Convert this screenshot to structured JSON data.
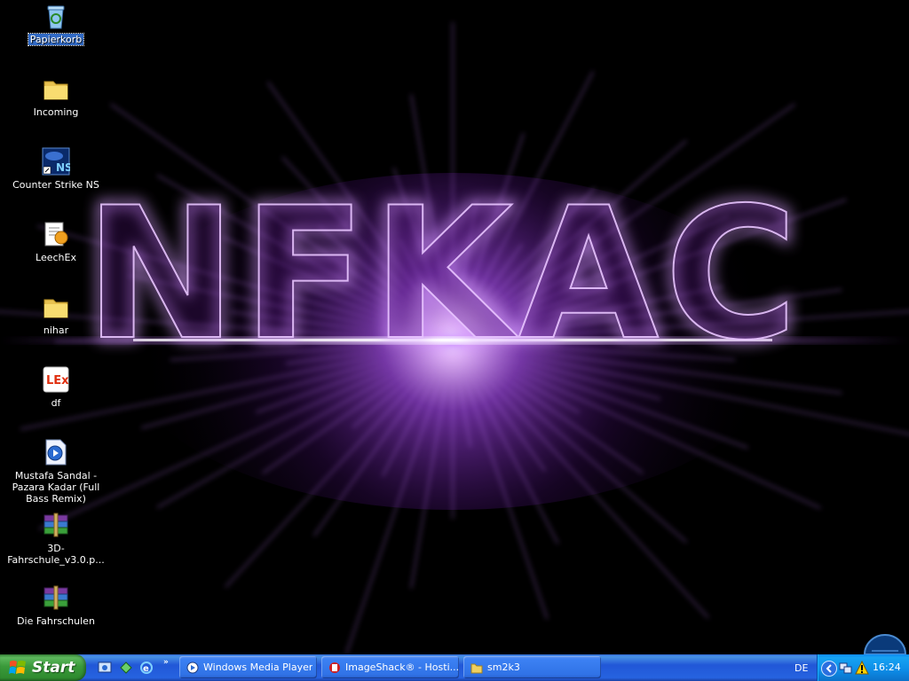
{
  "desktop": {
    "wallpaper_text": "NFKAC",
    "icons": [
      {
        "label": "Papierkorb",
        "icon": "recycle-bin-icon"
      },
      {
        "label": "Incoming",
        "icon": "folder-icon"
      },
      {
        "label": "Counter Strike NS",
        "icon": "counter-strike-shortcut-icon"
      },
      {
        "label": "LeechEx",
        "icon": "leechex-icon"
      },
      {
        "label": "nihar",
        "icon": "folder-icon"
      },
      {
        "label": "df",
        "icon": "lex-document-icon"
      },
      {
        "label": "Mustafa Sandal - Pazara Kadar (Full Bass Remix)",
        "icon": "media-file-icon"
      },
      {
        "label": "3D-Fahrschule_v3.0.p...",
        "icon": "winrar-archive-icon"
      },
      {
        "label": "Die Fahrschulen",
        "icon": "winrar-archive-icon"
      }
    ]
  },
  "taskbar": {
    "start_label": "Start",
    "quick_launch": [
      "show-desktop-icon",
      "network-icon",
      "internet-explorer-icon"
    ],
    "overflow": "»",
    "tasks": [
      {
        "label": "Windows Media Player",
        "icon": "media-player-icon"
      },
      {
        "label": "ImageShack® - Hosti...",
        "icon": "imageshack-icon"
      },
      {
        "label": "sm2k3",
        "icon": "folder-icon"
      }
    ],
    "language": "DE",
    "tray_icons": [
      "show-hidden-icons-icon",
      "network-connection-icon",
      "security-alert-icon"
    ],
    "clock": "16:24"
  },
  "colors": {
    "taskbar_blue": "#2663e0",
    "start_green": "#3a9a3a",
    "tray_blue": "#0d8ce6",
    "wallpaper_glow": "#b04cff",
    "selection": "#316ac5"
  }
}
